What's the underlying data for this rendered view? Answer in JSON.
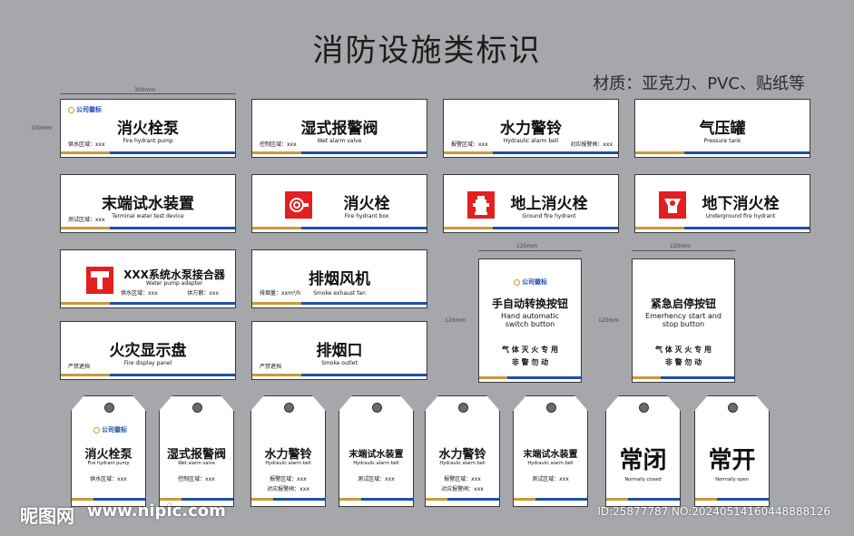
{
  "page": {
    "title": "消防设施类标识",
    "material": "材质：亚克力、PVC、贴纸等"
  },
  "dims": {
    "w300": "300mm",
    "h100": "100mm",
    "w120": "120mm",
    "h120": "120mm"
  },
  "logo": "公司徽标",
  "signs": [
    {
      "cn": "消火栓泵",
      "en": "Fire hydrant pump",
      "left": "供水区域：xxx",
      "right": ""
    },
    {
      "cn": "湿式报警阀",
      "en": "Wet alarm valve",
      "left": "控制区域：xxx",
      "right": ""
    },
    {
      "cn": "水力警铃",
      "en": "Hydraulic alarm bell",
      "left": "报警区域：xxx",
      "right": "对应报警阀：xxx"
    },
    {
      "cn": "气压罐",
      "en": "Pressure tank",
      "left": "",
      "right": ""
    },
    {
      "cn": "末端试水装置",
      "en": "Terminal water test device",
      "left": "测试区域：xxx",
      "right": ""
    },
    {
      "cn": "消火栓",
      "en": "Fire hydrant box",
      "left": "",
      "right": ""
    },
    {
      "cn": "地上消火栓",
      "en": "Ground fire hydrant",
      "left": "",
      "right": ""
    },
    {
      "cn": "地下消火栓",
      "en": "Underground fire hydrant",
      "left": "",
      "right": ""
    },
    {
      "cn": "XXX系统水泵接合器",
      "en": "Water pump adapter",
      "left": "供水区域：xxx",
      "right": "供方额：xxx"
    },
    {
      "cn": "排烟风机",
      "en": "Smoke exhaust fan",
      "left": "排烟量：xxm³/h",
      "right": ""
    },
    {
      "cn": "火灾显示盘",
      "en": "Fire display panel",
      "left": "严禁遮挡",
      "right": ""
    },
    {
      "cn": "排烟口",
      "en": "Smoke outlet",
      "left": "严禁遮挡",
      "right": ""
    }
  ],
  "panels": [
    {
      "cn": "手自动转换按钮",
      "en1": "Hand automatic",
      "en2": "switch button",
      "line1": "气 体 灭 火 专 用",
      "line2": "非 警 勿 动"
    },
    {
      "cn": "紧急启停按钮",
      "en1": "Emerhency start and",
      "en2": "stop button",
      "line1": "气 体 灭 火 专 用",
      "line2": "非 警 勿 动"
    }
  ],
  "tags": [
    {
      "cn": "消火栓泵",
      "en": "Fire hydrant pump",
      "f1": "供水区域：xxx",
      "f2": ""
    },
    {
      "cn": "湿式报警阀",
      "en": "Wet alarm valve",
      "f1": "控制区域：xxx",
      "f2": ""
    },
    {
      "cn": "水力警铃",
      "en": "Hydraulic alarm bell",
      "f1": "报警区域：xxx",
      "f2": "对应报警阀：xxx"
    },
    {
      "cn": "末端试水装置",
      "en": "Hydraulic alarm bell",
      "f1": "测试区域：xxx",
      "f2": ""
    },
    {
      "cn": "水力警铃",
      "en": "Hydraulic alarm bell",
      "f1": "报警区域：xxx",
      "f2": "对应报警阀：xxx"
    },
    {
      "cn": "末端试水装置",
      "en": "Hydraulic alarm bell",
      "f1": "测试区域：xxx",
      "f2": ""
    },
    {
      "cn": "常闭",
      "en": "Normally closed",
      "f1": "",
      "f2": ""
    },
    {
      "cn": "常开",
      "en": "Normally open",
      "f1": "",
      "f2": ""
    }
  ],
  "watermark": {
    "brand": "昵图网",
    "url": "www.nipic.com",
    "id": "ID:25877787 NO:20240514160448888126"
  }
}
